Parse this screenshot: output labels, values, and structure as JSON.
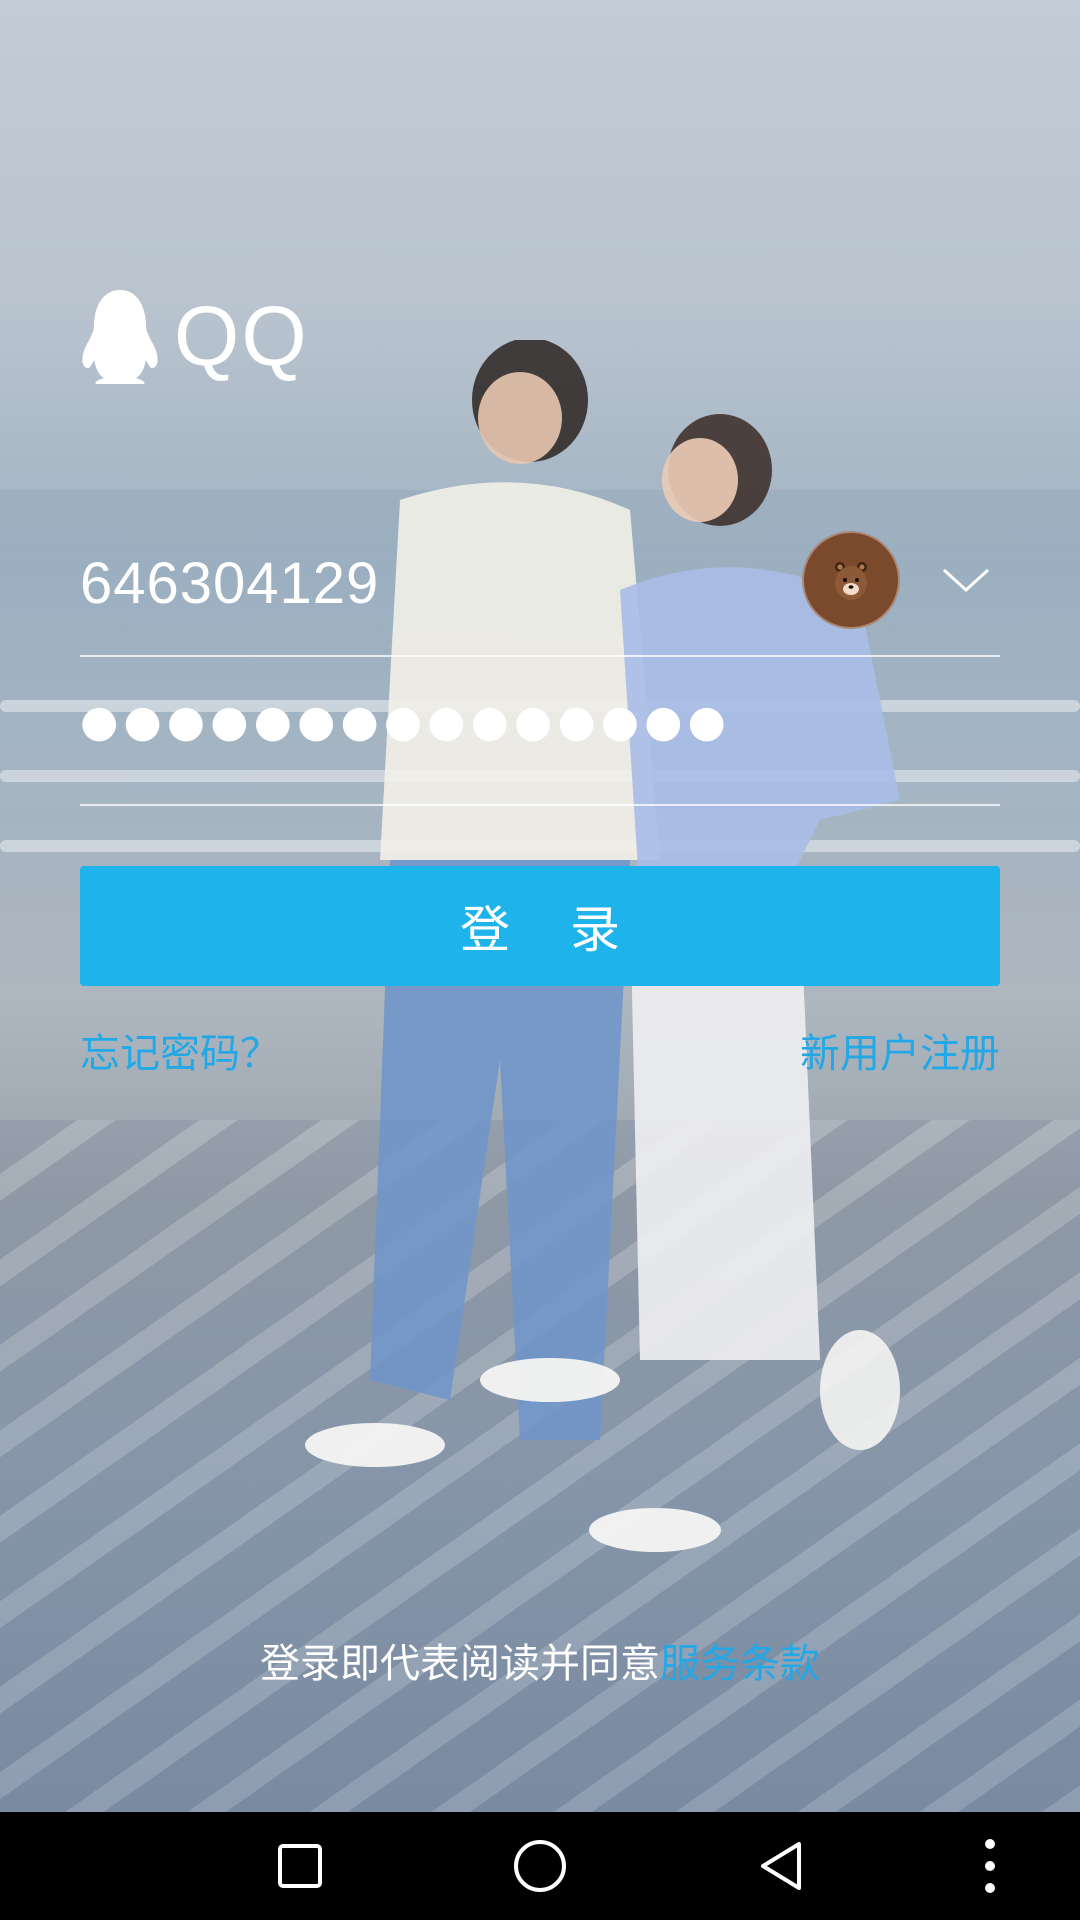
{
  "app": {
    "logo_text": "QQ"
  },
  "login_form": {
    "account_value": "646304129",
    "password_masked": "●●●●●●●●●●●●●●●",
    "login_label": "登 录",
    "forgot_password_label": "忘记密码？",
    "register_label": "新用户注册"
  },
  "terms": {
    "prefix": "登录即代表阅读并同意",
    "link_label": "服务条款"
  },
  "colors": {
    "accent": "#1fb3ec",
    "link": "#22a8e6",
    "navbar": "#000000",
    "avatar": "#7b4a2d"
  },
  "icons": {
    "logo": "qq-penguin-icon",
    "avatar": "bear-avatar-icon",
    "dropdown": "chevron-down-icon",
    "nav_recent": "square-recent-apps-icon",
    "nav_home": "circle-home-icon",
    "nav_back": "triangle-back-icon",
    "nav_more": "vertical-dots-menu-icon"
  }
}
